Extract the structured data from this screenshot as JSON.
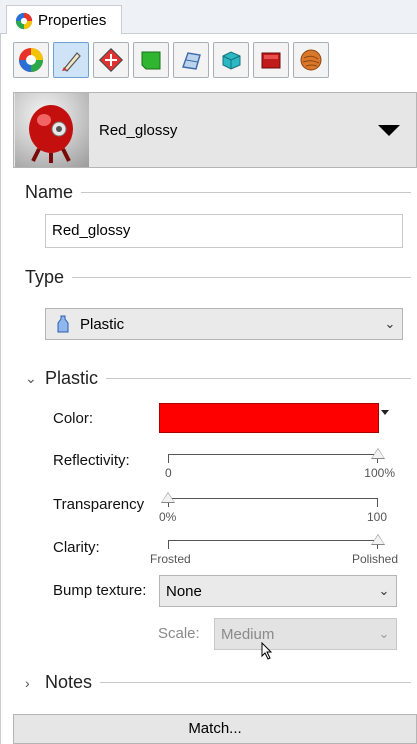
{
  "tab": {
    "label": "Properties"
  },
  "toolbar": {
    "buttons": [
      {
        "icon": "color-wheel-icon"
      },
      {
        "icon": "brush-icon",
        "active": true
      },
      {
        "icon": "linetype-icon"
      },
      {
        "icon": "green-surface-icon"
      },
      {
        "icon": "mesh-icon"
      },
      {
        "icon": "cube-icon"
      },
      {
        "icon": "red-box-icon"
      },
      {
        "icon": "texture-sphere-icon"
      }
    ]
  },
  "material": {
    "name": "Red_glossy"
  },
  "name_section": {
    "heading": "Name",
    "value": "Red_glossy"
  },
  "type_section": {
    "heading": "Type",
    "selected": "Plastic"
  },
  "plastic_section": {
    "heading": "Plastic",
    "color_label": "Color:",
    "color_value": "#ff0000",
    "reflectivity": {
      "label": "Reflectivity:",
      "min": "0",
      "max": "100%",
      "value_fraction": 1.0
    },
    "transparency": {
      "label": "Transparency",
      "min": "0%",
      "max": "100",
      "value_fraction": 0.0
    },
    "clarity": {
      "label": "Clarity:",
      "min": "Frosted",
      "max": "Polished",
      "value_fraction": 1.0
    },
    "bump": {
      "label": "Bump texture:",
      "selected": "None"
    },
    "scale": {
      "label": "Scale:",
      "selected": "Medium"
    }
  },
  "notes_section": {
    "heading": "Notes"
  },
  "match_button": {
    "label": "Match..."
  }
}
